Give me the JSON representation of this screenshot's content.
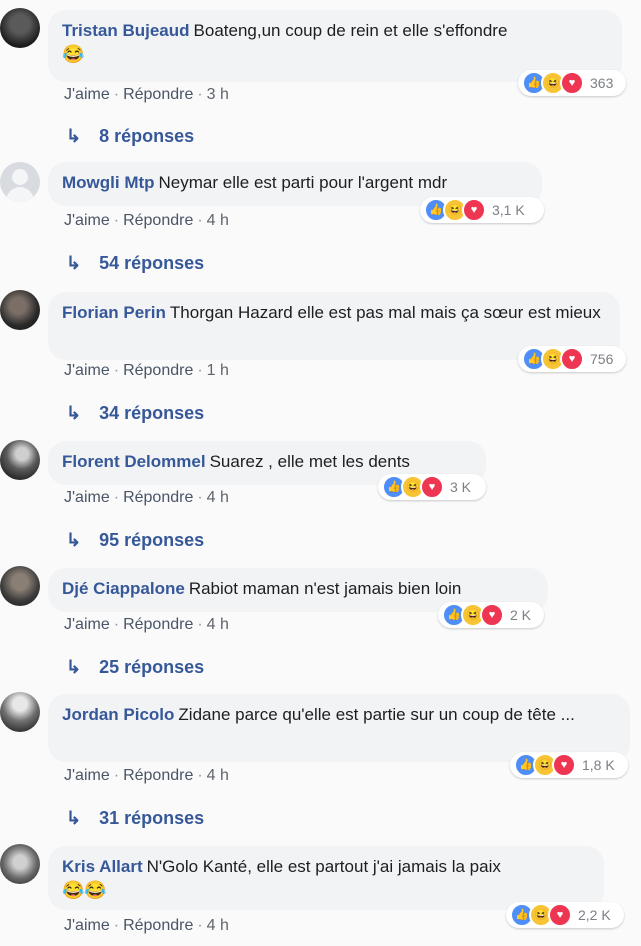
{
  "ui": {
    "like_label": "J'aime",
    "reply_label": "Répondre",
    "separator": "·",
    "reply_arrow": "↳",
    "reaction_icons": [
      "like-icon",
      "haha-icon",
      "love-icon"
    ],
    "colors": {
      "author": "#365899",
      "like": "#4f8ef7",
      "haha": "#f7c435",
      "love": "#ee3551"
    }
  },
  "comments": [
    {
      "author": "Tristan Bujeaud",
      "text": "Boateng,un coup de rein et elle s'effondre",
      "emoji": "😂",
      "time": "3 h",
      "reactions": "363",
      "replies": "8 réponses"
    },
    {
      "author": "Mowgli Mtp",
      "text": "Neymar elle est parti pour l'argent mdr",
      "emoji": "",
      "time": "4 h",
      "reactions": "3,1 K",
      "replies": "54 réponses"
    },
    {
      "author": "Florian Perin",
      "text": "Thorgan Hazard elle est pas mal mais ça sœur est mieux",
      "emoji": "",
      "time": "1 h",
      "reactions": "756",
      "replies": "34 réponses"
    },
    {
      "author": "Florent Delommel",
      "text": "Suarez , elle met les dents",
      "emoji": "",
      "time": "4 h",
      "reactions": "3 K",
      "replies": "95 réponses"
    },
    {
      "author": "Djé Ciappalone",
      "text": "Rabiot maman n'est jamais bien loin",
      "emoji": "",
      "time": "4 h",
      "reactions": "2 K",
      "replies": "25 réponses"
    },
    {
      "author": "Jordan Picolo",
      "text": "Zidane parce qu'elle est partie sur un coup de tête ...",
      "emoji": "",
      "time": "4 h",
      "reactions": "1,8 K",
      "replies": "31 réponses"
    },
    {
      "author": "Kris Allart",
      "text": "N'Golo Kanté, elle est partout j'ai jamais la paix",
      "emoji": "😂😂",
      "time": "4 h",
      "reactions": "2,2 K",
      "replies": ""
    }
  ]
}
